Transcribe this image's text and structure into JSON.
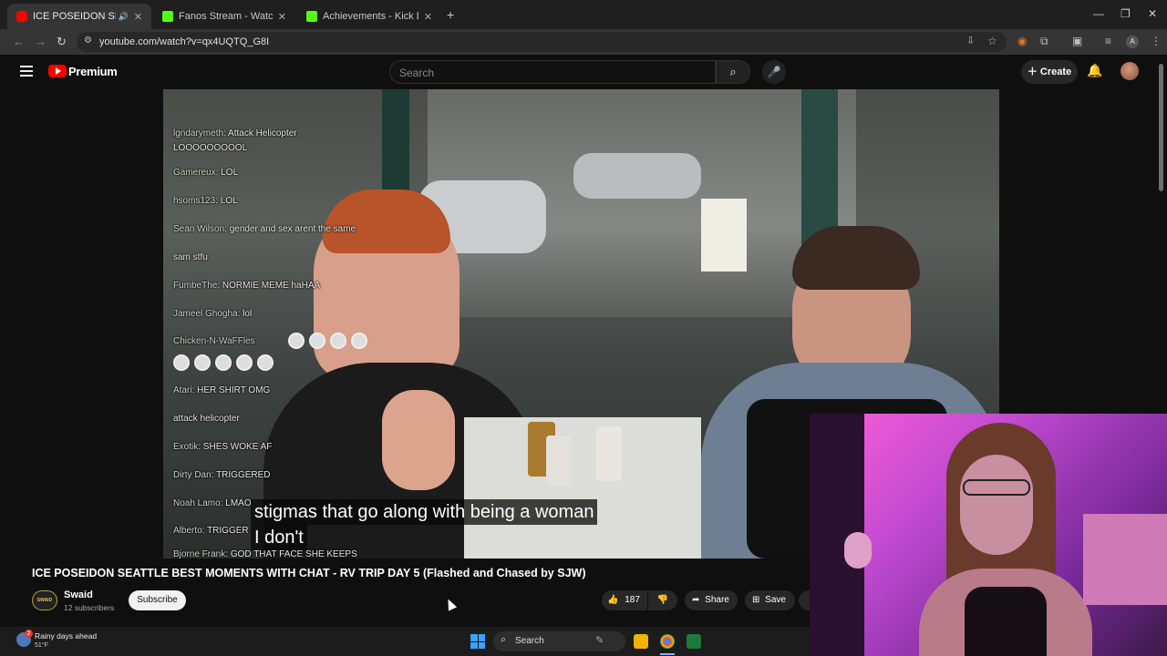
{
  "browser": {
    "tabs": [
      {
        "label": "ICE POSEIDON SEATTLE BE",
        "active": true
      },
      {
        "label": "Fanos Stream - Watch Live on K",
        "active": false
      },
      {
        "label": "Achievements - Kick Dashboard",
        "active": false
      }
    ],
    "url": "youtube.com/watch?v=qx4UQTQ_G8I"
  },
  "youtube": {
    "brand": "Premium",
    "search_placeholder": "Search",
    "create_label": "Create"
  },
  "video": {
    "chat": [
      {
        "user": "lgndarymeth:",
        "text": "Attack Helicopter"
      },
      {
        "user": "",
        "text": "LOOOOOOOOOL"
      },
      {
        "user": "Gamereux:",
        "text": "LOL"
      },
      {
        "user": "hsoms123:",
        "text": "LOL"
      },
      {
        "user": "Sean Wilson:",
        "text": "gender and sex arent the same"
      },
      {
        "user": "",
        "text": "sam stfu"
      },
      {
        "user": "FumbeThe:",
        "text": "NORMIE MEME haHAA"
      },
      {
        "user": "Jameel Ghogha:",
        "text": "lol"
      },
      {
        "user": "Chicken-N-WaFFles",
        "text": ""
      },
      {
        "user": "Atari:",
        "text": "HER SHIRT OMG"
      },
      {
        "user": "",
        "text": "attack helicopter"
      },
      {
        "user": "Exotik:",
        "text": "SHES WOKE AF"
      },
      {
        "user": "Dirty Dan:",
        "text": "TRIGGERED"
      },
      {
        "user": "Noah Lamo:",
        "text": "LMAO"
      },
      {
        "user": "Alberto:",
        "text": "TRIGGER"
      },
      {
        "user": "Bjorne Frank:",
        "text": "GOD THAT FACE SHE KEEPS"
      }
    ],
    "caption_lines": [
      "stigmas that go along with being a woman",
      "I don't"
    ]
  },
  "watch": {
    "title": "ICE POSEIDON SEATTLE BEST MOMENTS WITH CHAT - RV TRIP DAY 5 (Flashed and Chased by SJW)",
    "channel_name": "Swaid",
    "channel_avatar_text": "SWAID",
    "subscribers": "12 subscribers",
    "subscribe_label": "Subscribe",
    "like_count": "187",
    "share_label": "Share",
    "save_label": "Save"
  },
  "taskbar": {
    "weather_badge": "2",
    "weather_text": "Rainy days ahead",
    "weather_temp": "51°F",
    "search_label": "Search"
  },
  "colors": {
    "youtube_red": "#ff0000",
    "kick_green": "#53fc18",
    "webcam_pink": "#ff5fd7"
  }
}
